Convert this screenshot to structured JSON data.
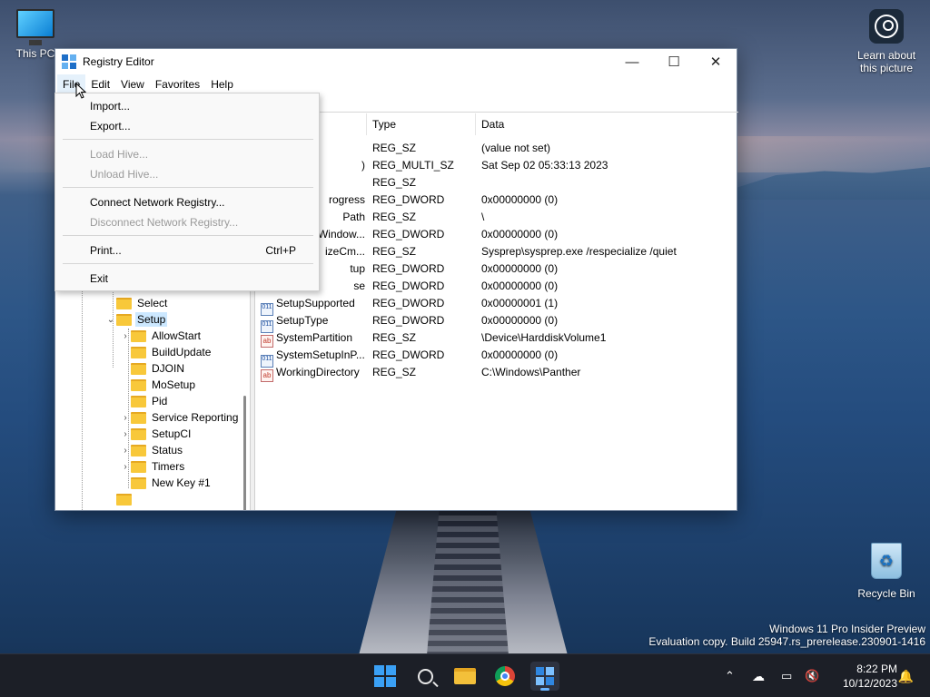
{
  "desktop": {
    "this_pc_label": "This PC",
    "learn_label": "Learn about this picture",
    "recycle_label": "Recycle Bin",
    "watermark_line1": "Windows 11 Pro Insider Preview",
    "watermark_line2": "Evaluation copy. Build 25947.rs_prerelease.230901-1416"
  },
  "window": {
    "title": "Registry Editor",
    "controls": {
      "minimize": "—",
      "maximize": "☐",
      "close": "✕"
    },
    "menus": [
      "File",
      "Edit",
      "View",
      "Favorites",
      "Help"
    ]
  },
  "file_menu": {
    "items": [
      {
        "label": "Import...",
        "enabled": true,
        "shortcut": ""
      },
      {
        "label": "Export...",
        "enabled": true,
        "shortcut": ""
      },
      {
        "label": "Load Hive...",
        "enabled": false,
        "shortcut": ""
      },
      {
        "label": "Unload Hive...",
        "enabled": false,
        "shortcut": ""
      },
      {
        "label": "Connect Network Registry...",
        "enabled": true,
        "shortcut": ""
      },
      {
        "label": "Disconnect Network Registry...",
        "enabled": false,
        "shortcut": ""
      },
      {
        "label": "Print...",
        "enabled": true,
        "shortcut": "Ctrl+P"
      },
      {
        "label": "Exit",
        "enabled": true,
        "shortcut": ""
      }
    ]
  },
  "tree": {
    "items": [
      {
        "label": "Select",
        "chevron": "",
        "selected": false
      },
      {
        "label": "Setup",
        "chevron": "⌄",
        "selected": true
      },
      {
        "label": "AllowStart",
        "chevron": "›",
        "selected": false
      },
      {
        "label": "BuildUpdate",
        "chevron": "",
        "selected": false
      },
      {
        "label": "DJOIN",
        "chevron": "",
        "selected": false
      },
      {
        "label": "MoSetup",
        "chevron": "",
        "selected": false
      },
      {
        "label": "Pid",
        "chevron": "",
        "selected": false
      },
      {
        "label": "Service Reporting",
        "chevron": "›",
        "selected": false
      },
      {
        "label": "SetupCI",
        "chevron": "›",
        "selected": false
      },
      {
        "label": "Status",
        "chevron": "›",
        "selected": false
      },
      {
        "label": "Timers",
        "chevron": "›",
        "selected": false
      },
      {
        "label": "New Key #1",
        "chevron": "",
        "selected": false
      }
    ]
  },
  "values": {
    "columns": [
      "Type",
      "Data"
    ],
    "rows": [
      {
        "name": "",
        "icon": "ab",
        "type": "REG_SZ",
        "data": "(value not set)"
      },
      {
        "name": ")",
        "icon": "ab",
        "type": "REG_MULTI_SZ",
        "data": "Sat Sep 02 05:33:13 2023"
      },
      {
        "name": "",
        "icon": "ab",
        "type": "REG_SZ",
        "data": ""
      },
      {
        "name": "rogress",
        "icon": "bin",
        "type": "REG_DWORD",
        "data": "0x00000000 (0)"
      },
      {
        "name": "Path",
        "icon": "ab",
        "type": "REG_SZ",
        "data": "\\"
      },
      {
        "name": "Window...",
        "icon": "bin",
        "type": "REG_DWORD",
        "data": "0x00000000 (0)"
      },
      {
        "name": "izeCm...",
        "icon": "ab",
        "type": "REG_SZ",
        "data": "Sysprep\\sysprep.exe /respecialize /quiet"
      },
      {
        "name": "tup",
        "icon": "bin",
        "type": "REG_DWORD",
        "data": "0x00000000 (0)"
      },
      {
        "name": "se",
        "icon": "bin",
        "type": "REG_DWORD",
        "data": "0x00000000 (0)"
      },
      {
        "name": "SetupSupported",
        "icon": "bin",
        "type": "REG_DWORD",
        "data": "0x00000001 (1)"
      },
      {
        "name": "SetupType",
        "icon": "bin",
        "type": "REG_DWORD",
        "data": "0x00000000 (0)"
      },
      {
        "name": "SystemPartition",
        "icon": "ab",
        "type": "REG_SZ",
        "data": "\\Device\\HarddiskVolume1"
      },
      {
        "name": "SystemSetupInP...",
        "icon": "bin",
        "type": "REG_DWORD",
        "data": "0x00000000 (0)"
      },
      {
        "name": "WorkingDirectory",
        "icon": "ab",
        "type": "REG_SZ",
        "data": "C:\\Windows\\Panther"
      }
    ]
  },
  "taskbar": {
    "apps": [
      "start",
      "search",
      "file-explorer",
      "chrome",
      "registry-editor"
    ],
    "active_app": "registry-editor",
    "time": "8:22 PM",
    "date": "10/12/2023"
  }
}
